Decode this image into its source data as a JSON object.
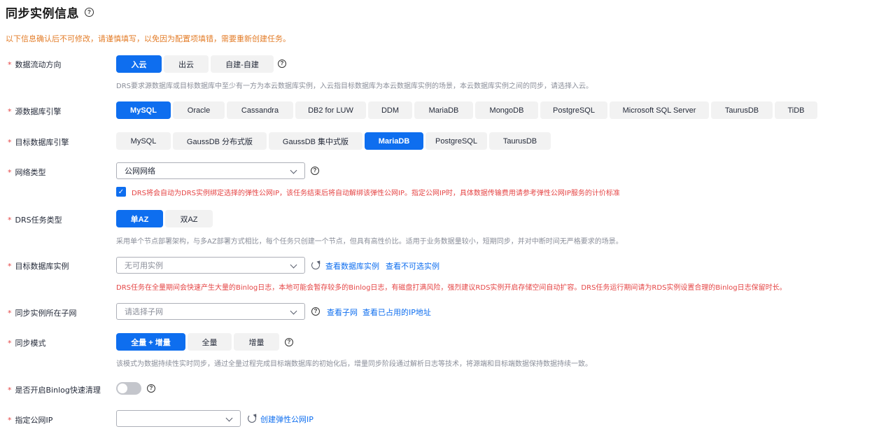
{
  "page": {
    "title": "同步实例信息",
    "notice": "以下信息确认后不可修改，请谨慎填写，以免因为配置项填错，需要重新创建任务。"
  },
  "flow": {
    "label": "数据流动方向",
    "options": [
      "入云",
      "出云",
      "自建-自建"
    ],
    "selected": "入云",
    "hint": "DRS要求源数据库或目标数据库中至少有一方为本云数据库实例，入云指目标数据库为本云数据库实例的场景，本云数据库实例之间的同步，请选择入云。"
  },
  "source_engine": {
    "label": "源数据库引擎",
    "options": [
      "MySQL",
      "Oracle",
      "Cassandra",
      "DB2 for LUW",
      "DDM",
      "MariaDB",
      "MongoDB",
      "PostgreSQL",
      "Microsoft SQL Server",
      "TaurusDB",
      "TiDB"
    ],
    "selected": "MySQL"
  },
  "target_engine": {
    "label": "目标数据库引擎",
    "options": [
      "MySQL",
      "GaussDB 分布式版",
      "GaussDB 集中式版",
      "MariaDB",
      "PostgreSQL",
      "TaurusDB"
    ],
    "selected": "MariaDB"
  },
  "network": {
    "label": "网络类型",
    "value": "公网网络",
    "checkbox_text": "DRS将会自动为DRS实例绑定选择的弹性公网IP，该任务结束后将自动解绑该弹性公网IP。指定公网IP时，具体数据传输费用请参考弹性公网IP服务的计价标准"
  },
  "task_type": {
    "label": "DRS任务类型",
    "options": [
      "单AZ",
      "双AZ"
    ],
    "selected": "单AZ",
    "hint": "采用单个节点部署架构，与多AZ部署方式相比，每个任务只创建一个节点，但具有高性价比。适用于业务数据量较小，短期同步，并对中断时间无严格要求的场景。"
  },
  "target_instance": {
    "label": "目标数据库实例",
    "value": "无可用实例",
    "link_view": "查看数据库实例",
    "link_unavailable": "查看不可选实例",
    "warning": "DRS任务在全量期间会快速产生大量的Binlog日志，本地可能会暂存较多的Binlog日志，有磁盘打满风险，强烈建议RDS实例开启存储空间自动扩容。DRS任务运行期间请为RDS实例设置合理的Binlog日志保留时长。"
  },
  "subnet": {
    "label": "同步实例所在子网",
    "placeholder": "请选择子网",
    "link_view": "查看子网",
    "link_used_ip": "查看已占用的IP地址"
  },
  "sync_mode": {
    "label": "同步模式",
    "options": [
      "全量 + 增量",
      "全量",
      "增量"
    ],
    "selected": "全量 + 增量",
    "hint": "该模式为数据持续性实时同步，通过全量过程完成目标端数据库的初始化后，增量同步阶段通过解析日志等技术，将源端和目标端数据保持数据持续一致。"
  },
  "binlog_clean": {
    "label": "是否开启Binlog快速清理",
    "enabled": false
  },
  "public_ip": {
    "label": "指定公网IP",
    "value": "",
    "link_create": "创建弹性公网IP"
  },
  "colors": {
    "primary": "#0e6eef",
    "required": "#e54545",
    "notice": "#e37d29",
    "hint": "#8a8e99"
  },
  "icons": [
    "help-icon",
    "chevron-down-icon",
    "refresh-icon",
    "checkmark-icon"
  ]
}
